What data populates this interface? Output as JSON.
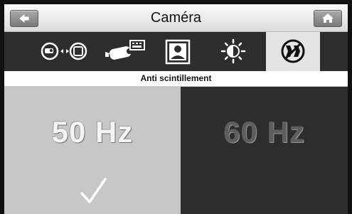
{
  "header": {
    "title": "Caméra",
    "back_icon": "back-arrow-icon",
    "home_icon": "home-icon"
  },
  "tabs": [
    {
      "name": "camera-switch",
      "icon": "camera-switch-icon",
      "active": false
    },
    {
      "name": "camera-record",
      "icon": "camera-record-icon",
      "active": false
    },
    {
      "name": "portrait",
      "icon": "portrait-icon",
      "active": false
    },
    {
      "name": "brightness",
      "icon": "brightness-icon",
      "active": false
    },
    {
      "name": "anti-flicker",
      "icon": "anti-flicker-icon",
      "active": true
    }
  ],
  "section": {
    "title": "Anti scintillement"
  },
  "options": [
    {
      "label": "50 Hz",
      "selected": true
    },
    {
      "label": "60 Hz",
      "selected": false
    }
  ],
  "colors": {
    "titlebar": "#e8e8e8",
    "tabbar": "#2d2d2d",
    "selected_panel": "#c7c7c7",
    "unselected_panel": "#2d2d2d"
  }
}
